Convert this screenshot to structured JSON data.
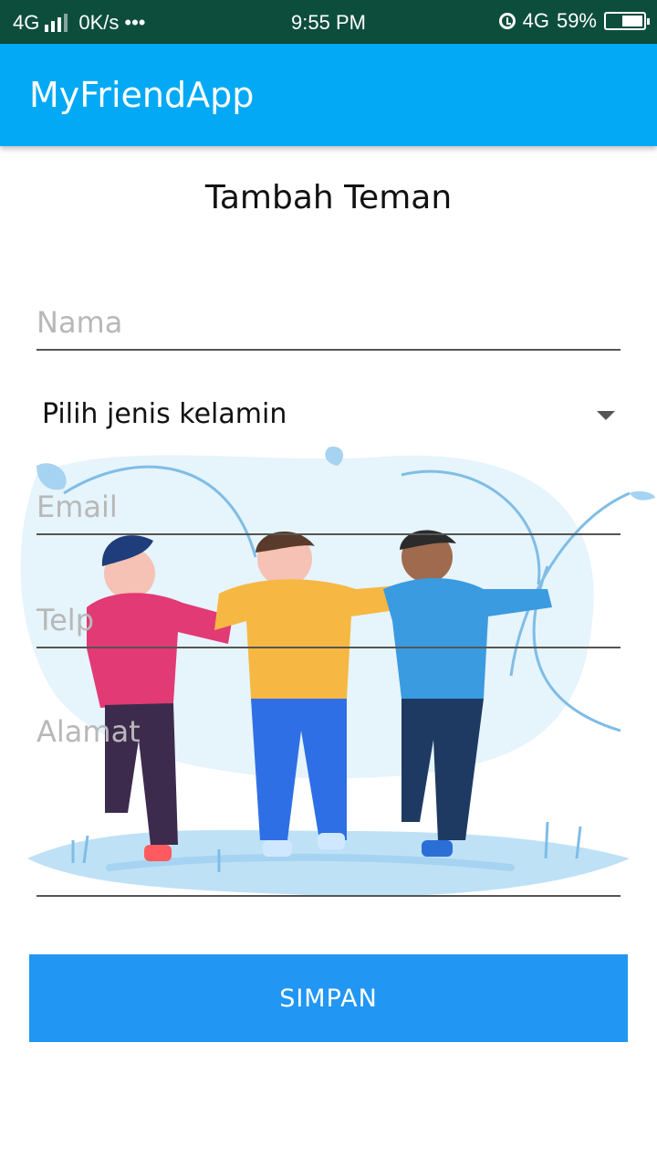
{
  "status_bar": {
    "network": "4G",
    "speed": "0K/s",
    "dots": "•••",
    "time": "9:55 PM",
    "network2": "4G",
    "battery": "59%",
    "battery_level": 0.59
  },
  "app_bar": {
    "title": "MyFriendApp"
  },
  "form": {
    "heading": "Tambah Teman",
    "name_placeholder": "Nama",
    "gender_spinner": "Pilih jenis kelamin",
    "email_placeholder": "Email",
    "phone_placeholder": "Telp",
    "address_placeholder": "Alamat",
    "save_label": "SIMPAN"
  },
  "colors": {
    "status_bar": "#0d4d3c",
    "app_bar": "#03a9f4",
    "button": "#2196f3"
  },
  "icons": [
    "signal-icon",
    "alarm-icon",
    "battery-icon",
    "dropdown-arrow-icon"
  ]
}
